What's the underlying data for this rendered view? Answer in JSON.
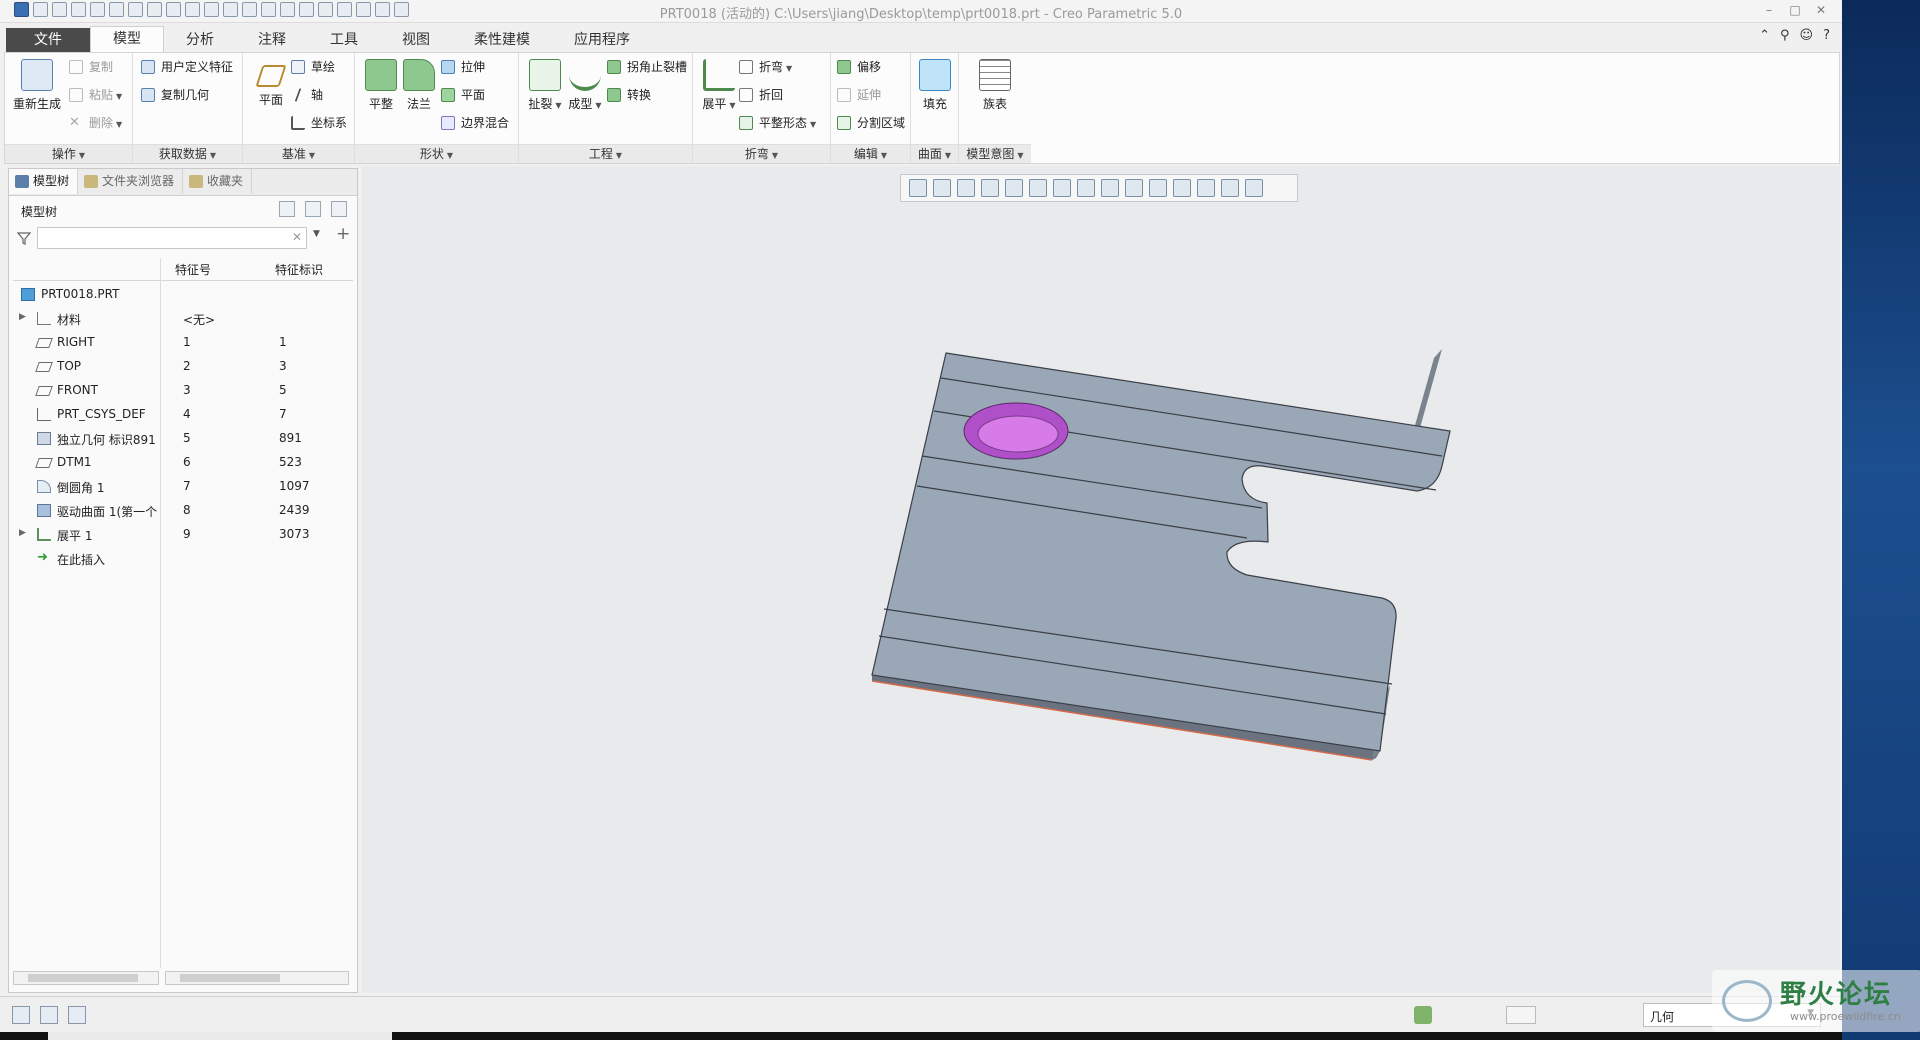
{
  "window": {
    "title": "PRT0018 (活动的) C:\\Users\\jiang\\Desktop\\temp\\prt0018.prt - Creo Parametric 5.0",
    "controls": [
      "–",
      "□",
      "✕"
    ]
  },
  "tabs": [
    {
      "label": "文件"
    },
    {
      "label": "模型"
    },
    {
      "label": "分析"
    },
    {
      "label": "注释"
    },
    {
      "label": "工具"
    },
    {
      "label": "视图"
    },
    {
      "label": "柔性建模"
    },
    {
      "label": "应用程序"
    }
  ],
  "ribbon": {
    "operations": {
      "label": "操作",
      "regenerate": "重新生成",
      "copy": "复制",
      "paste": "粘贴",
      "delete": "删除"
    },
    "get_data": {
      "label": "获取数据",
      "udf": "用户定义特征",
      "copy_geom": "复制几何"
    },
    "datum": {
      "label": "基准",
      "plane": "平面",
      "sketch": "草绘",
      "axis": "轴",
      "csys": "坐标系"
    },
    "shapes": {
      "label": "形状",
      "flat": "平整",
      "flange": "法兰",
      "extrude": "拉伸",
      "plane": "平面",
      "blend": "边界混合"
    },
    "engineering": {
      "label": "工程",
      "rip": "扯裂",
      "form": "成型",
      "corner_relief": "拐角止裂槽",
      "convert": "转换"
    },
    "bends": {
      "label": "折弯",
      "unbend": "展平",
      "bend": "折弯",
      "bend_back": "折回",
      "flat_state": "平整形态"
    },
    "editing": {
      "label": "编辑",
      "offset": "偏移",
      "extend": "延伸",
      "split": "分割区域"
    },
    "surfaces": {
      "label": "曲面",
      "fill": "填充"
    },
    "model_intent": {
      "label": "模型意图",
      "family_table": "族表"
    }
  },
  "panel": {
    "tabs": [
      "模型树",
      "文件夹浏览器",
      "收藏夹"
    ],
    "header": "模型树",
    "filter_placeholder": "",
    "columns": [
      "特征号",
      "特征标识"
    ],
    "root": "PRT0018.PRT",
    "rows": [
      {
        "name": "材料",
        "num": "<无>",
        "id": ""
      },
      {
        "name": "RIGHT",
        "num": "1",
        "id": "1"
      },
      {
        "name": "TOP",
        "num": "2",
        "id": "3"
      },
      {
        "name": "FRONT",
        "num": "3",
        "id": "5"
      },
      {
        "name": "PRT_CSYS_DEF",
        "num": "4",
        "id": "7"
      },
      {
        "name": "独立几何 标识891",
        "num": "5",
        "id": "891"
      },
      {
        "name": "DTM1",
        "num": "6",
        "id": "523"
      },
      {
        "name": "倒圆角 1",
        "num": "7",
        "id": "1097"
      },
      {
        "name": "驱动曲面 1(第一个",
        "num": "8",
        "id": "2439"
      },
      {
        "name": "展平 1",
        "num": "9",
        "id": "3073"
      },
      {
        "name": "在此插入",
        "num": "",
        "id": ""
      }
    ]
  },
  "status": {
    "filter_value": "几何"
  },
  "watermark": {
    "main": "野火论坛",
    "url": "www.proewildfire.cn"
  },
  "colors": {
    "accent": "#4a4a4a",
    "model_face": "#9aa7b6",
    "model_edge": "#3a3f47",
    "highlight": "#c15cd8"
  }
}
